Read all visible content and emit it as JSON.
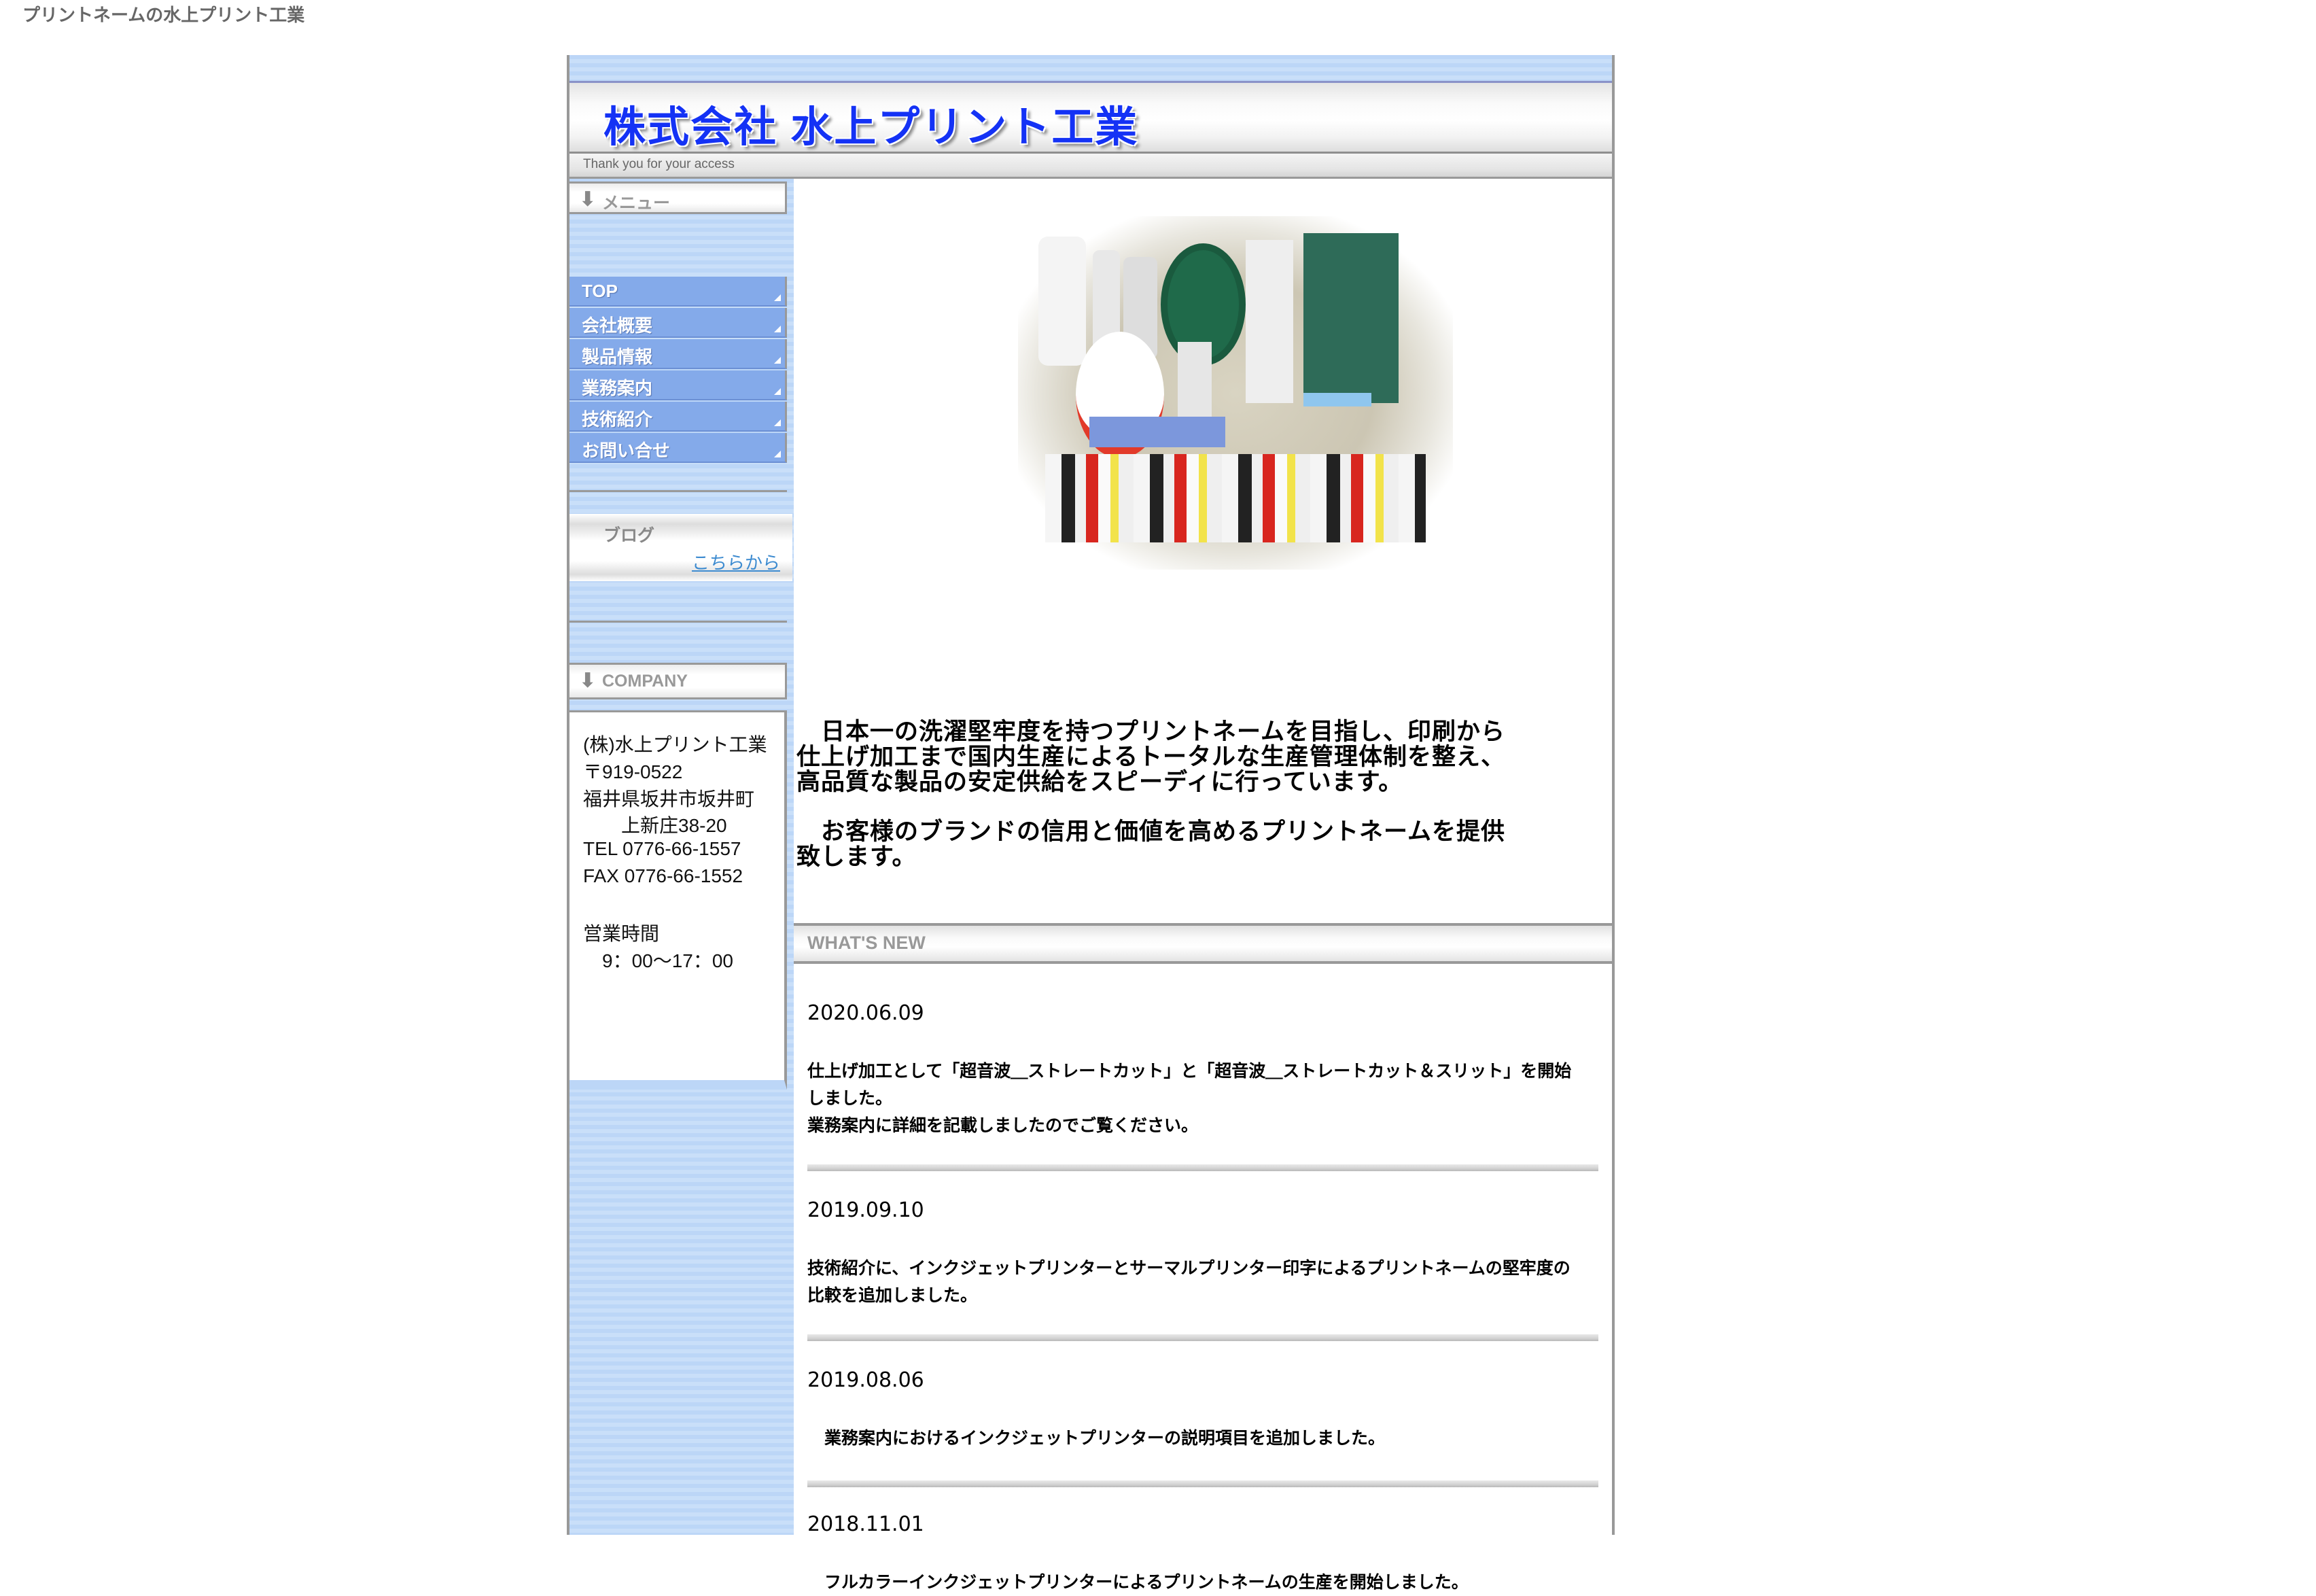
{
  "page_title": "プリントネームの水上プリント工業",
  "header": {
    "logo_text": "株式会社 水上プリント工業",
    "tagline": "Thank you for your access"
  },
  "sidebar": {
    "menu_header": "メニュー",
    "nav": [
      {
        "label": "TOP"
      },
      {
        "label": "会社概要"
      },
      {
        "label": "製品情報"
      },
      {
        "label": "業務案内"
      },
      {
        "label": "技術紹介"
      },
      {
        "label": "お問い合せ"
      }
    ],
    "blog": {
      "title": "ブログ",
      "link": "こちらから"
    },
    "company_header": "COMPANY",
    "company_lines": [
      "(株)水上プリント工業",
      "〒919-0522",
      "福井県坂井市坂井町",
      "　　上新庄38-20",
      "TEL 0776-66-1557",
      "FAX 0776-66-1552",
      "",
      "営業時間",
      "　9：00〜17：00"
    ]
  },
  "main": {
    "hero_alt": "プリントネーム製品写真",
    "intro": [
      "　日本一の洗濯堅牢度を持つプリントネームを目指し、印刷から\n仕上げ加工まで国内生産によるトータルな生産管理体制を整え、\n高品質な製品の安定供給をスピーディに行っています。",
      "　お客様のブランドの信用と価値を高めるプリントネームを提供\n致します。"
    ],
    "whats_new_label": "WHAT'S NEW",
    "news": [
      {
        "date": "2020.06.09",
        "body": "仕上げ加工として「超音波＿ストレートカット」と「超音波＿ストレートカット＆スリット」を開始\nしました。\n業務案内に詳細を記載しましたのでご覧ください。"
      },
      {
        "date": " 2019.09.10",
        "body": "技術紹介に、インクジェットプリンターとサーマルプリンター印字によるプリントネームの堅牢度の\n比較を追加しました。"
      },
      {
        "date": " 2019.08.06",
        "body": "　業務案内におけるインクジェットプリンターの説明項目を追加しました。"
      },
      {
        "date": "2018.11.01",
        "body": "　フルカラーインクジェットプリンターによるプリントネームの生産を開始しました。"
      }
    ]
  },
  "colors": {
    "logo_blue": "#1432f5",
    "nav_blue": "#84aaea",
    "band_blue": "#bcd6f7",
    "link_blue": "#3d8bd0"
  }
}
